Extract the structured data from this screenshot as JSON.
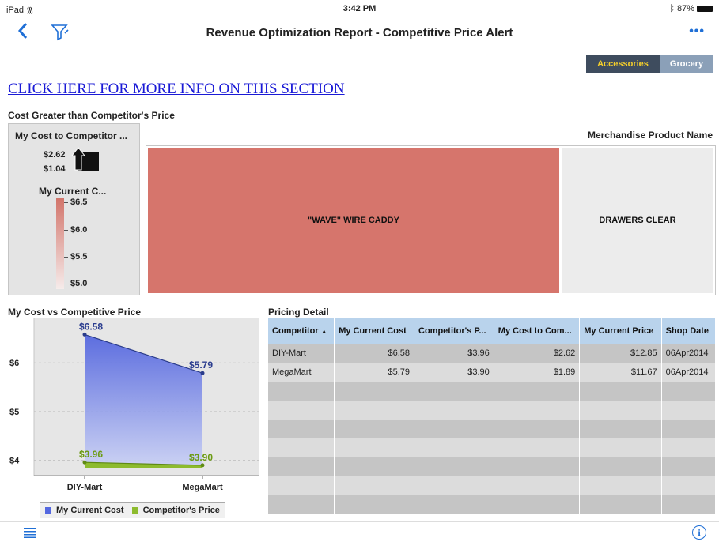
{
  "status_bar": {
    "device": "iPad",
    "time": "3:42 PM",
    "battery": "87%"
  },
  "nav": {
    "title": "Revenue Optimization Report - Competitive Price Alert",
    "more": "•••"
  },
  "segments": [
    {
      "label": "Accessories",
      "selected": true
    },
    {
      "label": "Grocery",
      "selected": false
    }
  ],
  "info_link": "CLICK HERE FOR MORE INFO ON THIS SECTION",
  "treemap_section": {
    "title": "Cost Greater than Competitor's Price",
    "legend": {
      "size_title": "My Cost to Competitor ...",
      "size_values": [
        "$2.62",
        "$1.04"
      ],
      "color_title": "My Current C...",
      "color_ticks": [
        "$6.5",
        "$6.0",
        "$5.5",
        "$5.0"
      ],
      "color_gradient": [
        "#d2746a",
        "#f6eceb"
      ]
    },
    "header": "Merchandise Product Name",
    "tiles": [
      {
        "label": "\"WAVE\" WIRE CADDY",
        "color": "#d6756c"
      },
      {
        "label": "DRAWERS CLEAR",
        "color": "#ececec"
      }
    ]
  },
  "chart_section": {
    "title": "My Cost vs Competitive Price"
  },
  "chart_data": {
    "type": "area",
    "categories": [
      "DIY-Mart",
      "MegaMart"
    ],
    "series": [
      {
        "name": "My Current Cost",
        "values": [
          6.58
        ],
        "labels": [
          "$6.58",
          "$5.79"
        ],
        "color": "#5468e0",
        "values_full": [
          6.58,
          5.79
        ]
      },
      {
        "name": "Competitor's Price",
        "values": [
          3.96
        ],
        "labels": [
          "$3.96",
          "$3.90"
        ],
        "color": "#8dbb2e",
        "values_full": [
          3.96,
          3.9
        ]
      }
    ],
    "y_ticks": [
      "$6",
      "$5",
      "$4"
    ],
    "ylim": [
      3.85,
      6.7
    ],
    "grid": true,
    "legend_position": "bottom"
  },
  "table_section": {
    "title": "Pricing Detail",
    "columns": [
      "Competitor",
      "My Current Cost",
      "Competitor's P...",
      "My Cost to Com...",
      "My Current Price",
      "Shop Date"
    ],
    "sort_indicator": "▲",
    "rows": [
      [
        "DIY-Mart",
        "$6.58",
        "$3.96",
        "$2.62",
        "$12.85",
        "06Apr2014"
      ],
      [
        "MegaMart",
        "$5.79",
        "$3.90",
        "$1.89",
        "$11.67",
        "06Apr2014"
      ]
    ]
  }
}
